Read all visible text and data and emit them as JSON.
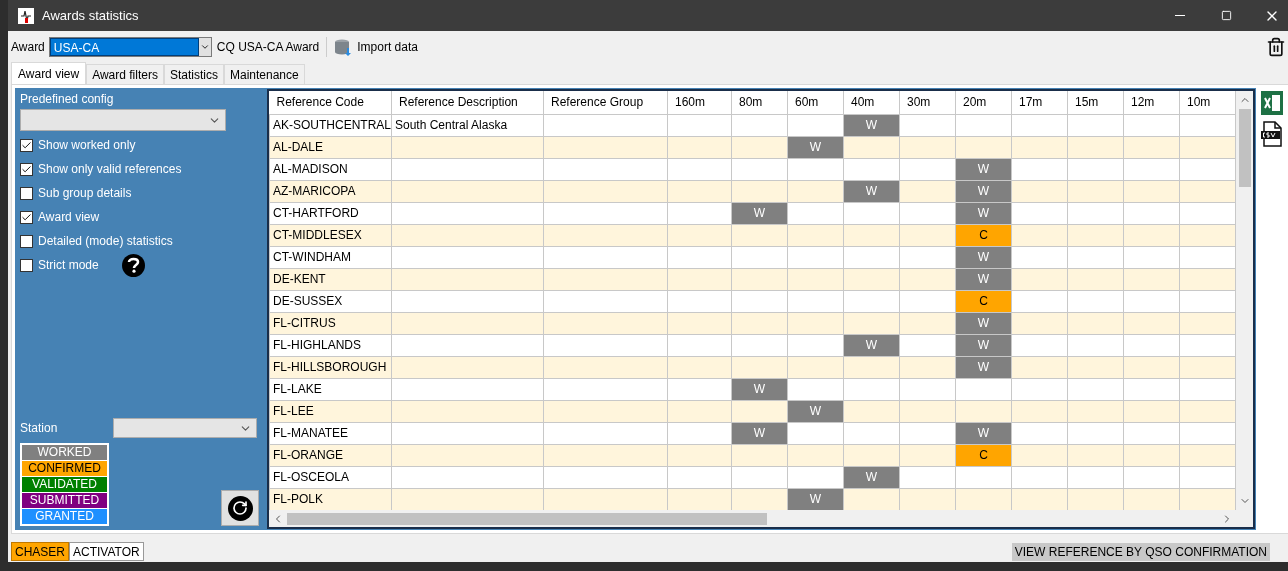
{
  "window": {
    "title": "Awards statistics"
  },
  "toolbar": {
    "award_label": "Award",
    "award_value": "USA-CA",
    "award_name": "CQ USA-CA Award",
    "import_button": "Import data"
  },
  "tabs": [
    {
      "label": "Award view",
      "selected": true
    },
    {
      "label": "Award filters",
      "selected": false
    },
    {
      "label": "Statistics",
      "selected": false
    },
    {
      "label": "Maintenance",
      "selected": false
    }
  ],
  "options": {
    "predefined_label": "Predefined config",
    "checkboxes": [
      {
        "label": "Show worked only",
        "checked": true
      },
      {
        "label": "Show only valid references",
        "checked": true
      },
      {
        "label": "Sub group details",
        "checked": false
      },
      {
        "label": "Award view",
        "checked": true
      },
      {
        "label": "Detailed (mode) statistics",
        "checked": false
      },
      {
        "label": "Strict mode",
        "checked": false
      }
    ],
    "station_label": "Station"
  },
  "legend": [
    {
      "label": "WORKED",
      "color": "#808080"
    },
    {
      "label": "CONFIRMED",
      "color": "#ffa500"
    },
    {
      "label": "VALIDATED",
      "color": "#008000"
    },
    {
      "label": "SUBMITTED",
      "color": "#800080"
    },
    {
      "label": "GRANTED",
      "color": "#1e90ff"
    }
  ],
  "table": {
    "columns": [
      "Reference Code",
      "Reference Description",
      "Reference Group",
      "160m",
      "80m",
      "60m",
      "40m",
      "30m",
      "20m",
      "17m",
      "15m",
      "12m",
      "10m"
    ],
    "rows": [
      {
        "cells": [
          "AK-SOUTHCENTRAL",
          "South Central Alaska",
          "",
          "",
          "",
          "",
          {
            "text": "W",
            "kind": "worked"
          },
          "",
          "",
          "",
          "",
          "",
          ""
        ]
      },
      {
        "cells": [
          "AL-DALE",
          "",
          "",
          "",
          "",
          {
            "text": "W",
            "kind": "worked"
          },
          "",
          "",
          "",
          "",
          "",
          "",
          ""
        ]
      },
      {
        "cells": [
          "AL-MADISON",
          "",
          "",
          "",
          "",
          "",
          "",
          "",
          {
            "text": "W",
            "kind": "worked"
          },
          "",
          "",
          "",
          ""
        ]
      },
      {
        "cells": [
          "AZ-MARICOPA",
          "",
          "",
          "",
          "",
          "",
          {
            "text": "W",
            "kind": "worked"
          },
          "",
          {
            "text": "W",
            "kind": "worked"
          },
          "",
          "",
          "",
          ""
        ]
      },
      {
        "cells": [
          "CT-HARTFORD",
          "",
          "",
          "",
          {
            "text": "W",
            "kind": "worked"
          },
          "",
          "",
          "",
          {
            "text": "W",
            "kind": "worked"
          },
          "",
          "",
          "",
          ""
        ]
      },
      {
        "cells": [
          "CT-MIDDLESEX",
          "",
          "",
          "",
          "",
          "",
          "",
          "",
          {
            "text": "C",
            "kind": "confirmed"
          },
          "",
          "",
          "",
          ""
        ]
      },
      {
        "cells": [
          "CT-WINDHAM",
          "",
          "",
          "",
          "",
          "",
          "",
          "",
          {
            "text": "W",
            "kind": "worked"
          },
          "",
          "",
          "",
          ""
        ]
      },
      {
        "cells": [
          "DE-KENT",
          "",
          "",
          "",
          "",
          "",
          "",
          "",
          {
            "text": "W",
            "kind": "worked"
          },
          "",
          "",
          "",
          ""
        ]
      },
      {
        "cells": [
          "DE-SUSSEX",
          "",
          "",
          "",
          "",
          "",
          "",
          "",
          {
            "text": "C",
            "kind": "confirmed"
          },
          "",
          "",
          "",
          ""
        ]
      },
      {
        "cells": [
          "FL-CITRUS",
          "",
          "",
          "",
          "",
          "",
          "",
          "",
          {
            "text": "W",
            "kind": "worked"
          },
          "",
          "",
          "",
          ""
        ]
      },
      {
        "cells": [
          "FL-HIGHLANDS",
          "",
          "",
          "",
          "",
          "",
          {
            "text": "W",
            "kind": "worked"
          },
          "",
          {
            "text": "W",
            "kind": "worked"
          },
          "",
          "",
          "",
          ""
        ]
      },
      {
        "cells": [
          "FL-HILLSBOROUGH",
          "",
          "",
          "",
          "",
          "",
          "",
          "",
          {
            "text": "W",
            "kind": "worked"
          },
          "",
          "",
          "",
          ""
        ]
      },
      {
        "cells": [
          "FL-LAKE",
          "",
          "",
          "",
          {
            "text": "W",
            "kind": "worked"
          },
          "",
          "",
          "",
          "",
          "",
          "",
          "",
          ""
        ]
      },
      {
        "cells": [
          "FL-LEE",
          "",
          "",
          "",
          "",
          {
            "text": "W",
            "kind": "worked"
          },
          "",
          "",
          "",
          "",
          "",
          "",
          ""
        ]
      },
      {
        "cells": [
          "FL-MANATEE",
          "",
          "",
          "",
          {
            "text": "W",
            "kind": "worked"
          },
          "",
          "",
          "",
          {
            "text": "W",
            "kind": "worked"
          },
          "",
          "",
          "",
          ""
        ]
      },
      {
        "cells": [
          "FL-ORANGE",
          "",
          "",
          "",
          "",
          "",
          "",
          "",
          {
            "text": "C",
            "kind": "confirmed"
          },
          "",
          "",
          "",
          ""
        ]
      },
      {
        "cells": [
          "FL-OSCEOLA",
          "",
          "",
          "",
          "",
          "",
          {
            "text": "W",
            "kind": "worked"
          },
          "",
          "",
          "",
          "",
          "",
          ""
        ]
      },
      {
        "cells": [
          "FL-POLK",
          "",
          "",
          "",
          "",
          {
            "text": "W",
            "kind": "worked"
          },
          "",
          "",
          "",
          "",
          "",
          "",
          ""
        ]
      }
    ]
  },
  "mode_tabs": [
    {
      "label": "CHASER",
      "selected": true
    },
    {
      "label": "ACTIVATOR",
      "selected": false
    }
  ],
  "status_bar": "VIEW REFERENCE BY QSO CONFIRMATION"
}
